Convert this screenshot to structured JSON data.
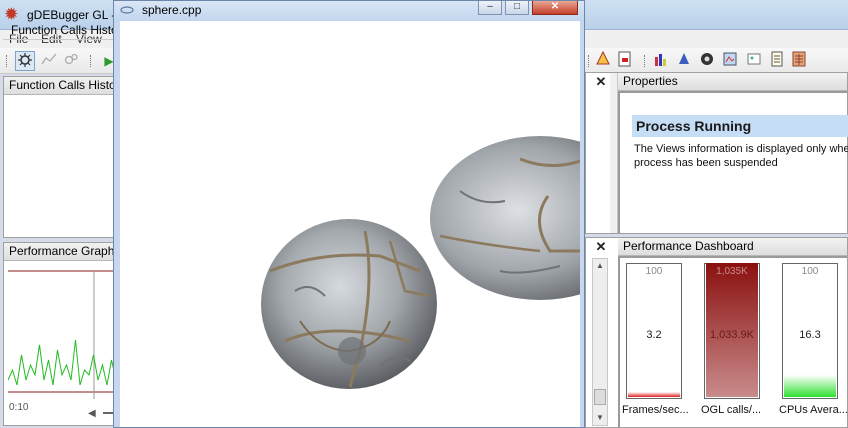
{
  "main_window": {
    "title": "gDEBugger GL -",
    "menu": [
      "File",
      "Edit",
      "View"
    ]
  },
  "sphere_window": {
    "title": "sphere.cpp",
    "minimize_glyph": "–",
    "maximize_glyph": "□",
    "close_glyph": "✕"
  },
  "function_calls_history": {
    "header": "Function Calls History",
    "tab_label": "Function Calls History"
  },
  "performance_graph": {
    "header": "Performance Graph",
    "time_label": "0:10",
    "series_values": [
      3,
      5,
      2,
      8,
      3,
      6,
      4,
      10,
      3,
      7,
      2,
      9,
      4,
      6,
      3,
      11,
      2,
      5,
      4,
      8,
      3,
      6,
      2,
      7,
      3
    ],
    "line_color": "#22bb22",
    "limit_color": "#8b1a1a"
  },
  "properties": {
    "header": "Properties",
    "heading": "Process Running",
    "text_line1": "The Views information is displayed only whe",
    "text_line2": "process has been suspended"
  },
  "performance_dashboard": {
    "header": "Performance Dashboard",
    "counters": [
      {
        "label": "Frames/sec...",
        "max": "100",
        "value_text": "3.2",
        "fraction": 0.032,
        "color": "#e02020"
      },
      {
        "label": "OGL calls/...",
        "max": "1,035K",
        "value_text": "1,033.9K",
        "fraction": 0.999,
        "color": "#8b1010"
      },
      {
        "label": "CPUs Avera...",
        "max": "100",
        "value_text": "16.3",
        "fraction": 0.163,
        "color": "#30e030"
      }
    ]
  },
  "colors": {
    "accent": "#c6ddf6",
    "title_bar": "#c3d6ef"
  }
}
